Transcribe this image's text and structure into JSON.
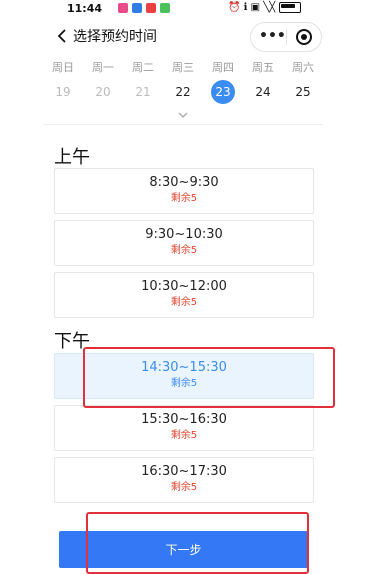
{
  "status_bar": {
    "time": "11:44",
    "sys_text": "⏰ ℹ ▣ ╲╳"
  },
  "header": {
    "title": "选择预约时间",
    "more": "•••"
  },
  "week": {
    "days": [
      {
        "name": "周日",
        "date": "19",
        "state": "past"
      },
      {
        "name": "周一",
        "date": "20",
        "state": "past"
      },
      {
        "name": "周二",
        "date": "21",
        "state": "past"
      },
      {
        "name": "周三",
        "date": "22",
        "state": "active"
      },
      {
        "name": "周四",
        "date": "23",
        "state": "selected"
      },
      {
        "name": "周五",
        "date": "24",
        "state": "active"
      },
      {
        "name": "周六",
        "date": "25",
        "state": "active"
      }
    ]
  },
  "morning": {
    "title": "上午",
    "slots": [
      {
        "time": "8:30~9:30",
        "remain": "剩余5"
      },
      {
        "time": "9:30~10:30",
        "remain": "剩余5"
      },
      {
        "time": "10:30~12:00",
        "remain": "剩余5"
      }
    ]
  },
  "afternoon": {
    "title": "下午",
    "slots": [
      {
        "time": "14:30~15:30",
        "remain": "剩余5",
        "selected": true
      },
      {
        "time": "15:30~16:30",
        "remain": "剩余5"
      },
      {
        "time": "16:30~17:30",
        "remain": "剩余5"
      }
    ]
  },
  "next_button": {
    "label": "下一步"
  },
  "colors": {
    "accent": "#3b8cf0",
    "button": "#3478f6",
    "remain": "#e0442f",
    "highlight": "#e0303a"
  }
}
